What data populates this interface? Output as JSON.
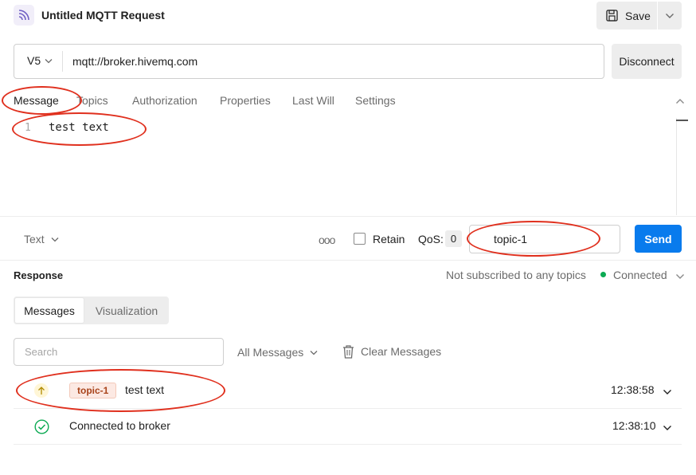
{
  "header": {
    "title": "Untitled MQTT Request",
    "save_label": "Save"
  },
  "url_bar": {
    "version": "V5",
    "url": "mqtt://broker.hivemq.com",
    "disconnect_label": "Disconnect"
  },
  "tabs": [
    {
      "label": "Message",
      "active": true
    },
    {
      "label": "Topics",
      "active": false
    },
    {
      "label": "Authorization",
      "active": false
    },
    {
      "label": "Properties",
      "active": false
    },
    {
      "label": "Last Will",
      "active": false
    },
    {
      "label": "Settings",
      "active": false
    }
  ],
  "editor": {
    "line_number": "1",
    "content": "test text"
  },
  "send_row": {
    "format": "Text",
    "more_label": "ooo",
    "retain_label": "Retain",
    "qos_label": "QoS:",
    "qos_value": "0",
    "topic_value": "topic-1",
    "send_label": "Send"
  },
  "response": {
    "title": "Response",
    "subscription_status": "Not subscribed to any topics",
    "connection_status": "Connected",
    "tabs": [
      "Messages",
      "Visualization"
    ],
    "search_placeholder": "Search",
    "filter_label": "All Messages",
    "clear_label": "Clear Messages",
    "messages": [
      {
        "topic": "topic-1",
        "text": "test text",
        "time": "12:38:58"
      },
      {
        "text": "Connected to broker",
        "time": "12:38:10"
      }
    ]
  },
  "colors": {
    "accent": "#097bed",
    "connected": "#0caa53",
    "annotation": "#e0301e",
    "topic_badge_text": "#a8431a"
  }
}
